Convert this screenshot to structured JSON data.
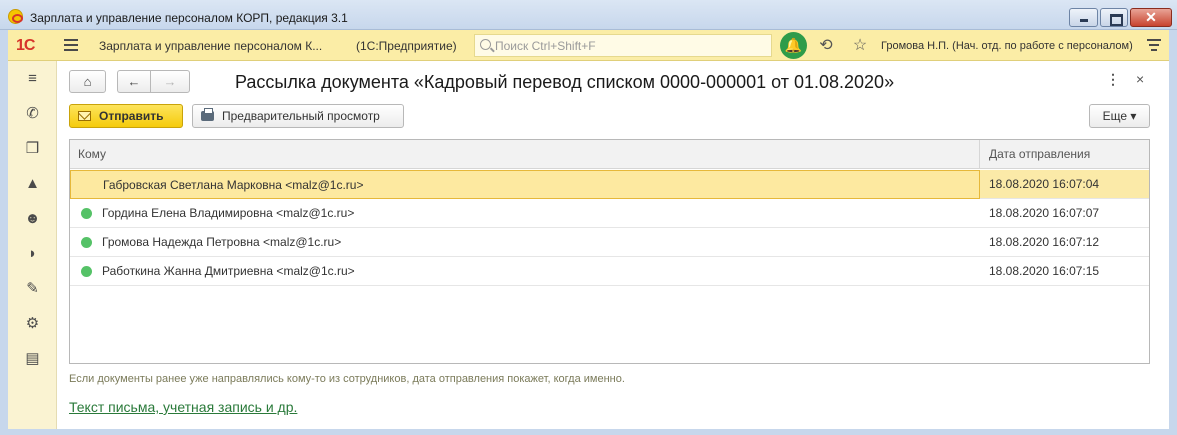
{
  "window": {
    "title": "Зарплата и управление персоналом КОРП, редакция 3.1",
    "close_glyph": "✕"
  },
  "toolbar": {
    "logo": "1С",
    "app_title": "Зарплата и управление персоналом К...",
    "mode": "(1С:Предприятие)",
    "search_placeholder": "Поиск Ctrl+Shift+F",
    "bell_glyph": "🔔",
    "history_glyph": "⟲",
    "favorite_glyph": "☆",
    "user": "Громова Н.П. (Нач. отд. по работе с персоналом)"
  },
  "sidebar": {
    "items": [
      {
        "icon": "menu-icon",
        "glyph": "≡"
      },
      {
        "icon": "phone-icon",
        "glyph": "✆"
      },
      {
        "icon": "gift-icon",
        "glyph": "❒"
      },
      {
        "icon": "graduation-cap-icon",
        "glyph": "▲"
      },
      {
        "icon": "people-icon",
        "glyph": "☻"
      },
      {
        "icon": "helmet-icon",
        "glyph": "◗"
      },
      {
        "icon": "wrench-icon",
        "glyph": "✎"
      },
      {
        "icon": "gear-icon",
        "glyph": "⚙"
      },
      {
        "icon": "id-card-icon",
        "glyph": "▤"
      }
    ]
  },
  "form": {
    "home_glyph": "⌂",
    "back_glyph": "←",
    "forward_glyph": "→",
    "title": "Рассылка документа «Кадровый перевод списком 0000-000001 от 01.08.2020»",
    "more_glyph": "⋮",
    "close_glyph": "×",
    "send_label": "Отправить",
    "preview_label": "Предварительный просмотр",
    "more_label": "Еще ▾"
  },
  "table": {
    "columns": [
      "Кому",
      "Дата отправления"
    ],
    "rows": [
      {
        "to": "Габровская Светлана Марковна <malz@1c.ru>",
        "date": "18.08.2020 16:07:04",
        "status_color": "#55c267"
      },
      {
        "to": "Гордина Елена Владимировна <malz@1c.ru>",
        "date": "18.08.2020 16:07:07",
        "status_color": "#55c267"
      },
      {
        "to": "Громова Надежда Петровна <malz@1c.ru>",
        "date": "18.08.2020 16:07:12",
        "status_color": "#55c267"
      },
      {
        "to": "Работкина Жанна Дмитриевна <malz@1c.ru>",
        "date": "18.08.2020 16:07:15",
        "status_color": "#55c267"
      }
    ],
    "selected_row": 0
  },
  "hint": "Если документы ранее уже направлялись кому-то из сотрудников, дата отправления покажет, когда именно.",
  "link": "Текст письма, учетная запись и др.",
  "colors": {
    "accent_yellow": "#f5cb0c",
    "toolbar_bg": "#fbeda6",
    "status_green": "#55c267",
    "link_green": "#2a7a3a"
  }
}
